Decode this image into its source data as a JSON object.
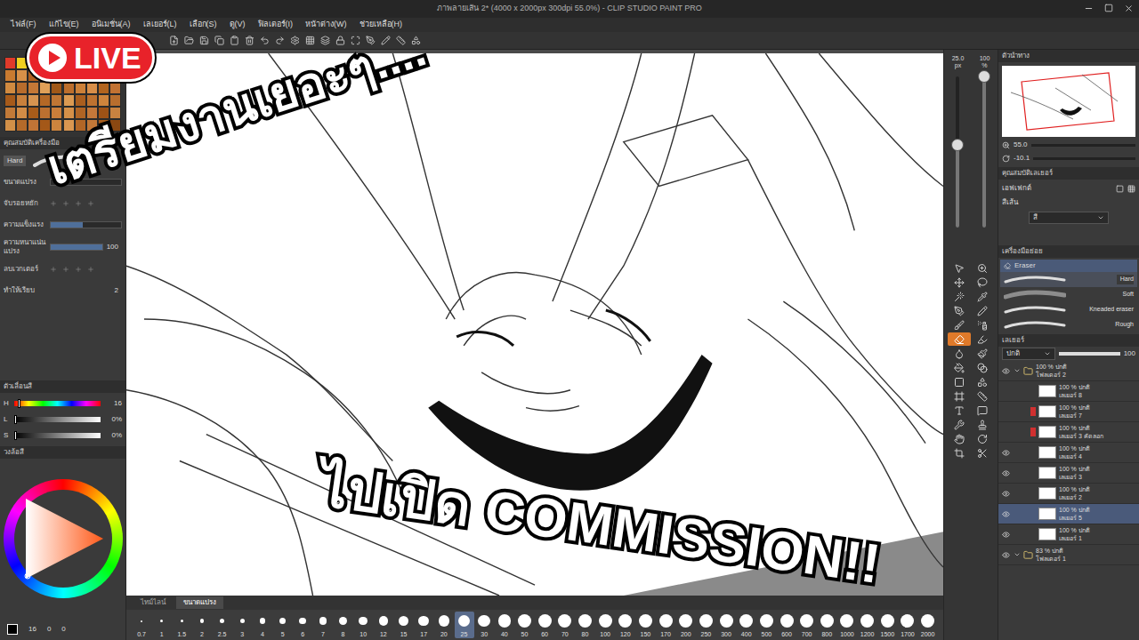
{
  "window": {
    "title": "ภาพลายเส้น 2* (4000 x 2000px 300dpi 55.0%) - CLIP STUDIO PAINT PRO"
  },
  "menu": [
    "ไฟล์(F)",
    "แก้ไข(E)",
    "อนิเมชั่น(A)",
    "เลเยอร์(L)",
    "เลือก(S)",
    "ดู(V)",
    "ฟิลเตอร์(I)",
    "หน้าต่าง(W)",
    "ช่วยเหลือ(H)"
  ],
  "live_badge": {
    "label": "LIVE"
  },
  "captions": {
    "top": "เตรียมงานเยอะๆ....",
    "bottom": "ไปเปิด COMMISSION!!"
  },
  "swatches": [
    "#e03a2a",
    "#f0d020",
    "#40b040",
    "#3070d0",
    "#ffffff",
    "#000000",
    "#c07030",
    "#d08840",
    "#b86a28",
    "#a85a20",
    "#c87a30",
    "#d89048",
    "#b06020",
    "#c06c28",
    "#e09a50",
    "#a85c1c",
    "#c47430",
    "#d48640",
    "#b8682a",
    "#9c5418",
    "#d08a40",
    "#b86c2c",
    "#c47836",
    "#e0a058",
    "#a05818",
    "#bc6e2c",
    "#cc8038",
    "#d88e48",
    "#b2641e",
    "#c27232",
    "#a65a1a",
    "#c8803c",
    "#d69450",
    "#b46826",
    "#c07634",
    "#dc9a52",
    "#aa5e1e",
    "#be7230",
    "#ce843c",
    "#b86e2e",
    "#c27a38",
    "#d28c46",
    "#a85c1a",
    "#bc7030",
    "#ca7e3a",
    "#d69048",
    "#b06424",
    "#c4783a",
    "#9e5216",
    "#c88240",
    "#d29048",
    "#b46a2a",
    "#c07436",
    "#a45818",
    "#cc843e",
    "#da9650",
    "#b26626",
    "#c27838",
    "#a65c1c",
    "#8a4812"
  ],
  "tool_property": {
    "header": "คุณสมบัติเครื่องมือ",
    "brush": "Hard",
    "settings": [
      {
        "label": "ขนาดแปรง",
        "value": "",
        "kind": "slider",
        "level": 0.0
      },
      {
        "label": "จับรอยหยัก",
        "value": "",
        "kind": "steps",
        "level": 0.0
      },
      {
        "label": "ความแข็งแรง",
        "value": "",
        "kind": "slider",
        "level": 0.45
      },
      {
        "label": "ความหนาแน่นแปรง",
        "value": "100",
        "kind": "slider",
        "level": 1.0
      },
      {
        "label": "ลบเวกเตอร์",
        "value": "",
        "kind": "steps",
        "level": 0.0
      },
      {
        "label": "ทำให้เรียบ",
        "value": "2",
        "kind": "value",
        "level": 0.0
      }
    ]
  },
  "color_slider": {
    "header": "ตัวเลื่อนสี",
    "channels": [
      {
        "name": "H",
        "reading": "16",
        "level": 0.04
      },
      {
        "name": "L",
        "reading": "0%",
        "level": 0.0
      },
      {
        "name": "S",
        "reading": "0%",
        "level": 0.0
      }
    ]
  },
  "color_wheel": {
    "header": "วงล้อสี"
  },
  "left_status": [
    "16",
    "0",
    "0"
  ],
  "canvas_tabs": [
    {
      "label": "ไทม์ไลน์",
      "selected": false
    },
    {
      "label": "ขนาดแปรง",
      "selected": true
    }
  ],
  "brush_sizes": [
    {
      "label": "0.7",
      "selected": false
    },
    {
      "label": "1",
      "selected": false
    },
    {
      "label": "1.5",
      "selected": false
    },
    {
      "label": "2",
      "selected": false
    },
    {
      "label": "2.5",
      "selected": false
    },
    {
      "label": "3",
      "selected": false
    },
    {
      "label": "4",
      "selected": false
    },
    {
      "label": "5",
      "selected": false
    },
    {
      "label": "6",
      "selected": false
    },
    {
      "label": "7",
      "selected": false
    },
    {
      "label": "8",
      "selected": false
    },
    {
      "label": "10",
      "selected": false
    },
    {
      "label": "12",
      "selected": false
    },
    {
      "label": "15",
      "selected": false
    },
    {
      "label": "17",
      "selected": false
    },
    {
      "label": "20",
      "selected": false
    },
    {
      "label": "25",
      "selected": true
    },
    {
      "label": "30",
      "selected": false
    },
    {
      "label": "40",
      "selected": false
    },
    {
      "label": "50",
      "selected": false
    },
    {
      "label": "60",
      "selected": false
    },
    {
      "label": "70",
      "selected": false
    },
    {
      "label": "80",
      "selected": false
    },
    {
      "label": "100",
      "selected": false
    },
    {
      "label": "120",
      "selected": false
    },
    {
      "label": "150",
      "selected": false
    },
    {
      "label": "170",
      "selected": false
    },
    {
      "label": "200",
      "selected": false
    },
    {
      "label": "250",
      "selected": false
    },
    {
      "label": "300",
      "selected": false
    },
    {
      "label": "400",
      "selected": false
    },
    {
      "label": "500",
      "selected": false
    },
    {
      "label": "600",
      "selected": false
    },
    {
      "label": "700",
      "selected": false
    },
    {
      "label": "800",
      "selected": false
    },
    {
      "label": "1000",
      "selected": false
    },
    {
      "label": "1200",
      "selected": false
    },
    {
      "label": "1500",
      "selected": false
    },
    {
      "label": "1700",
      "selected": false
    },
    {
      "label": "2000",
      "selected": false
    }
  ],
  "quick_sliders": {
    "size_reading": "25.0",
    "size_unit": "px",
    "size_level": 0.55,
    "opacity_reading": "100",
    "opacity_unit": "%",
    "opacity_level": 1.0
  },
  "tools": [
    {
      "kind": "pointer",
      "selected": false
    },
    {
      "kind": "zoom",
      "selected": false
    },
    {
      "kind": "move",
      "selected": false
    },
    {
      "kind": "lasso",
      "selected": false
    },
    {
      "kind": "wand",
      "selected": false
    },
    {
      "kind": "pipette",
      "selected": false
    },
    {
      "kind": "pen",
      "selected": false
    },
    {
      "kind": "pencil",
      "selected": false
    },
    {
      "kind": "brush",
      "selected": false
    },
    {
      "kind": "airbrush",
      "selected": false
    },
    {
      "kind": "eraser",
      "selected": true
    },
    {
      "kind": "marker",
      "selected": false
    },
    {
      "kind": "blend",
      "selected": false
    },
    {
      "kind": "paintbrush",
      "selected": false
    },
    {
      "kind": "fill",
      "selected": false
    },
    {
      "kind": "gradient",
      "selected": false
    },
    {
      "kind": "figure",
      "selected": false
    },
    {
      "kind": "shapes",
      "selected": false
    },
    {
      "kind": "frame",
      "selected": false
    },
    {
      "kind": "ruler",
      "selected": false
    },
    {
      "kind": "text",
      "selected": false
    },
    {
      "kind": "balloon",
      "selected": false
    },
    {
      "kind": "correct",
      "selected": false
    },
    {
      "kind": "stamp",
      "selected": false
    },
    {
      "kind": "hand",
      "selected": false
    },
    {
      "kind": "rotate",
      "selected": false
    },
    {
      "kind": "crop",
      "selected": false
    },
    {
      "kind": "cut",
      "selected": false
    }
  ],
  "navigator": {
    "header": "ตัวนำทาง",
    "zoom": "55.0",
    "angle": "-10.1"
  },
  "layer_property": {
    "header": "คุณสมบัติเลเยอร์",
    "effect_label": "เอฟเฟกต์",
    "color_label": "สีเส้น",
    "color_value": "สี"
  },
  "subtool": {
    "header": "เครื่องมือย่อย",
    "group": "Eraser",
    "items": [
      {
        "label": "Hard",
        "selected": true
      },
      {
        "label": "Soft",
        "selected": false
      },
      {
        "label": "Kneaded eraser",
        "selected": false
      },
      {
        "label": "Rough",
        "selected": false
      }
    ]
  },
  "layers_panel": {
    "header": "เลเยอร์",
    "blend": "ปกติ",
    "opacity": "100",
    "layers": [
      {
        "mode": "100 % ปกติ",
        "name": "โฟลเดอร์ 2",
        "kind": "folder",
        "visible": true,
        "selected": false,
        "clipped": false
      },
      {
        "mode": "100 % ปกติ",
        "name": "เลเยอร์ 8",
        "kind": "layer",
        "visible": false,
        "selected": false,
        "clipped": false
      },
      {
        "mode": "100 % ปกติ",
        "name": "เลเยอร์ 7",
        "kind": "layer",
        "visible": false,
        "selected": false,
        "clipped": true
      },
      {
        "mode": "100 % ปกติ",
        "name": "เลเยอร์ 3 คัดลอก",
        "kind": "layer",
        "visible": false,
        "selected": false,
        "clipped": true
      },
      {
        "mode": "100 % ปกติ",
        "name": "เลเยอร์ 4",
        "kind": "layer",
        "visible": true,
        "selected": false,
        "clipped": false
      },
      {
        "mode": "100 % ปกติ",
        "name": "เลเยอร์ 3",
        "kind": "layer",
        "visible": true,
        "selected": false,
        "clipped": false
      },
      {
        "mode": "100 % ปกติ",
        "name": "เลเยอร์ 2",
        "kind": "layer",
        "visible": true,
        "selected": false,
        "clipped": false
      },
      {
        "mode": "100 % ปกติ",
        "name": "เลเยอร์ 5",
        "kind": "layer",
        "visible": true,
        "selected": true,
        "clipped": false
      },
      {
        "mode": "100 % ปกติ",
        "name": "เลเยอร์ 1",
        "kind": "layer",
        "visible": true,
        "selected": false,
        "clipped": false
      },
      {
        "mode": "83 % ปกติ",
        "name": "โฟลเดอร์ 1",
        "kind": "folder",
        "visible": true,
        "selected": false,
        "clipped": false
      }
    ]
  }
}
